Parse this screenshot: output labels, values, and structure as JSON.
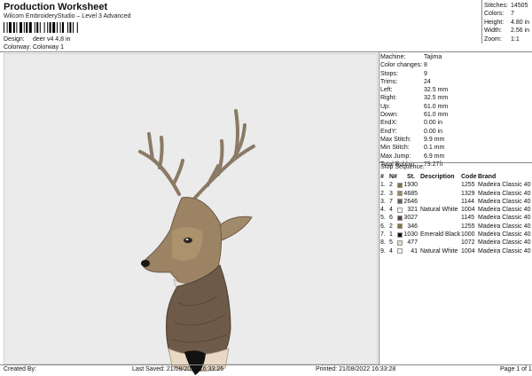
{
  "header": {
    "title": "Production Worksheet",
    "subtitle": "Wilcom EmbroideryStudio – Level 3 Advanced",
    "design_label": "Design:",
    "design_value": "deer v4 4,8 in",
    "colorway_label": "Colorway:",
    "colorway_value": "Colorway 1"
  },
  "stats": [
    {
      "label": "Stitches:",
      "value": "14505"
    },
    {
      "label": "Colors:",
      "value": "7"
    },
    {
      "label": "Height:",
      "value": "4.80 in"
    },
    {
      "label": "Width:",
      "value": "2.56 in"
    },
    {
      "label": "Zoom:",
      "value": "1:1"
    }
  ],
  "machine_info": [
    {
      "label": "Machine:",
      "value": "Tajima"
    },
    {
      "label": "Color changes:",
      "value": "8"
    },
    {
      "label": "Stops:",
      "value": "9"
    },
    {
      "label": "Trims:",
      "value": "24"
    },
    {
      "label": "Left:",
      "value": "32.5 mm"
    },
    {
      "label": "Right:",
      "value": "32.5 mm"
    },
    {
      "label": "Up:",
      "value": "61.0 mm"
    },
    {
      "label": "Down:",
      "value": "61.0 mm"
    },
    {
      "label": "EndX:",
      "value": "0.00 in"
    },
    {
      "label": "EndY:",
      "value": "0.00 in"
    },
    {
      "label": "Max Stitch:",
      "value": "9.9 mm"
    },
    {
      "label": "Min Stitch:",
      "value": "0.1 mm"
    },
    {
      "label": "Max Jump:",
      "value": "6.9 mm"
    },
    {
      "label": "Total Bobbin:",
      "value": "79.27ft"
    }
  ],
  "stop_sequence": {
    "title": "Stop Sequence:",
    "headers": {
      "stop": "#",
      "n": "N#",
      "st": "St.",
      "desc": "Description",
      "code": "Code",
      "brand": "Brand"
    },
    "rows": [
      {
        "stop": "1.",
        "n": "2",
        "color": "#8a6f4e",
        "st": "1930",
        "desc": "",
        "code": "1255",
        "brand": "Madeira Classic 40"
      },
      {
        "stop": "2.",
        "n": "3",
        "color": "#a08a6a",
        "st": "4685",
        "desc": "",
        "code": "1329",
        "brand": "Madeira Classic 40"
      },
      {
        "stop": "3.",
        "n": "7",
        "color": "#6e5a48",
        "st": "2646",
        "desc": "",
        "code": "1144",
        "brand": "Madeira Classic 40"
      },
      {
        "stop": "4.",
        "n": "4",
        "color": "#f4f4f0",
        "st": "321",
        "desc": "Natural White",
        "code": "1004",
        "brand": "Madeira Classic 40"
      },
      {
        "stop": "5.",
        "n": "6",
        "color": "#5e4535",
        "st": "3027",
        "desc": "",
        "code": "1145",
        "brand": "Madeira Classic 40"
      },
      {
        "stop": "6.",
        "n": "2",
        "color": "#8a6f4e",
        "st": "346",
        "desc": "",
        "code": "1255",
        "brand": "Madeira Classic 40"
      },
      {
        "stop": "7.",
        "n": "1",
        "color": "#111111",
        "st": "1030",
        "desc": "Emerald Black",
        "code": "1000",
        "brand": "Madeira Classic 40"
      },
      {
        "stop": "8.",
        "n": "5",
        "color": "#e8d8c4",
        "st": "477",
        "desc": "",
        "code": "1072",
        "brand": "Madeira Classic 40"
      },
      {
        "stop": "9.",
        "n": "4",
        "color": "#f4f4f0",
        "st": "41",
        "desc": "Natural White",
        "code": "1004",
        "brand": "Madeira Classic 40"
      }
    ]
  },
  "footer": {
    "created_by": "Created By:",
    "last_saved": "Last Saved: 21/08/2022 16:33:26",
    "printed": "Printed: 21/08/2022 16:33:28",
    "page": "Page 1 of 1"
  }
}
